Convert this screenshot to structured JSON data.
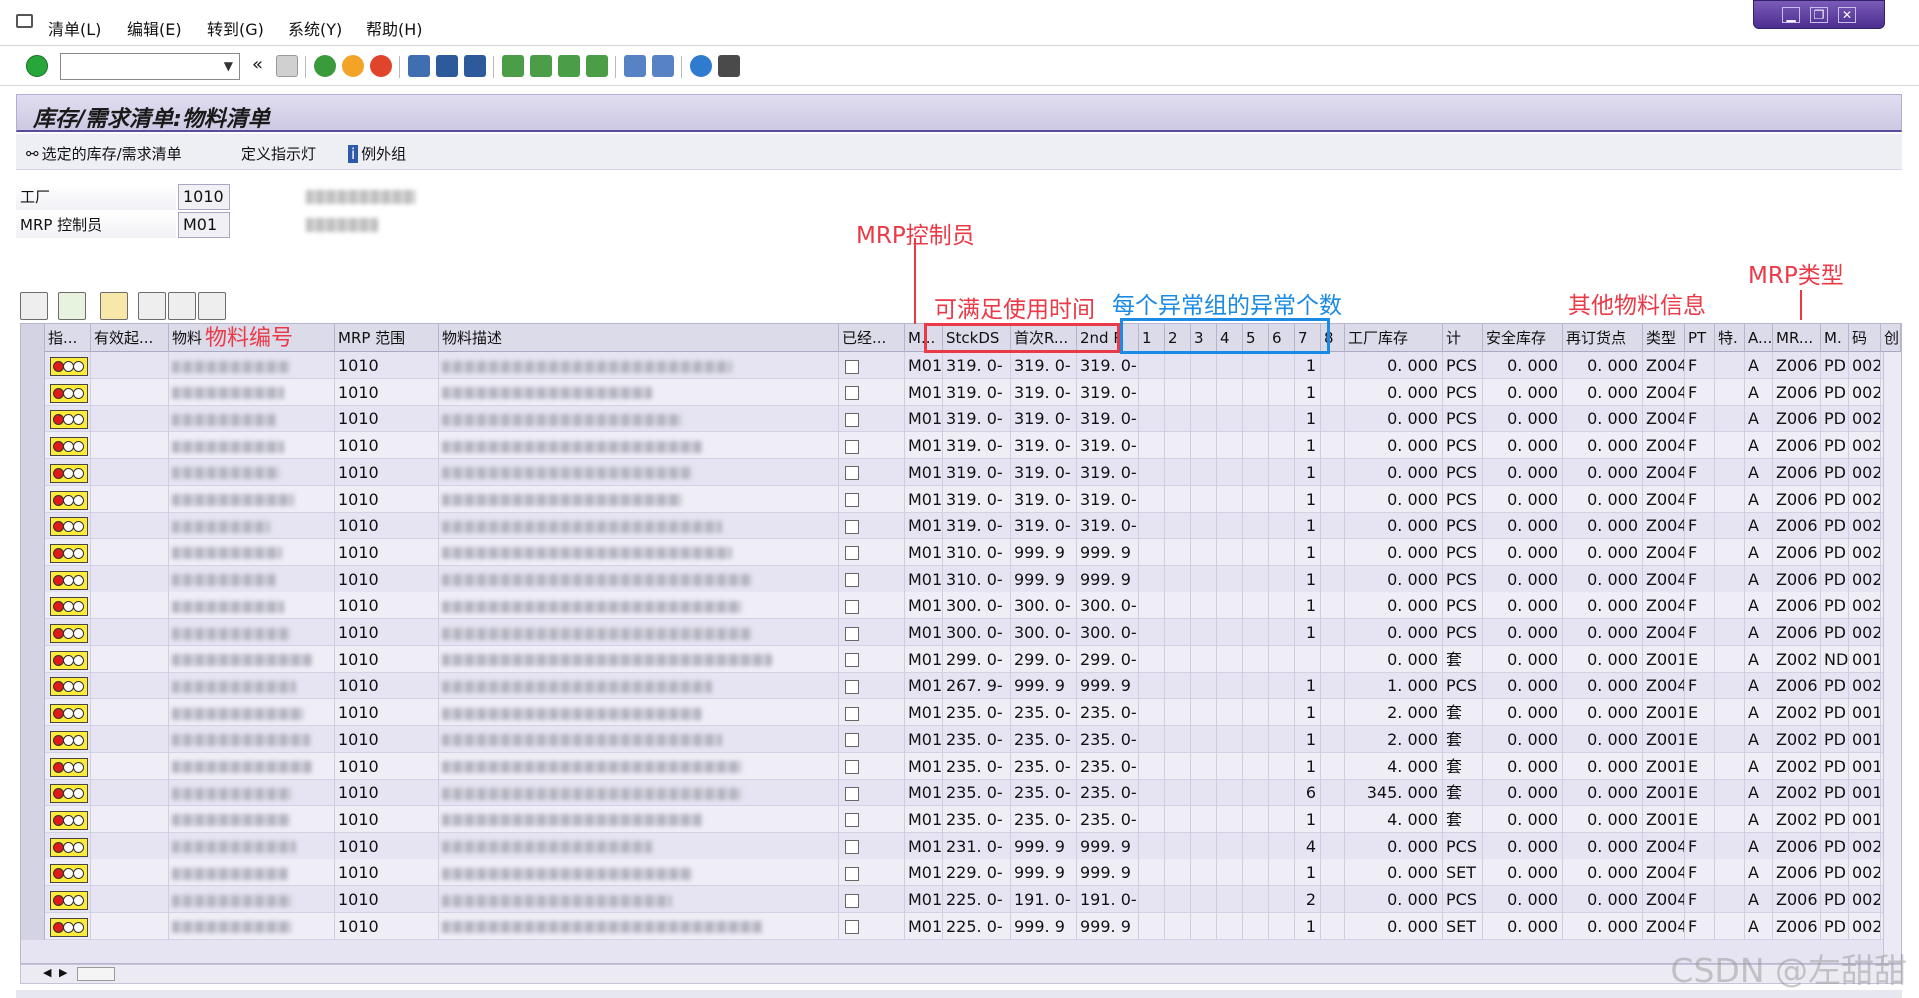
{
  "menu": [
    "清单(L)",
    "编辑(E)",
    "转到(G)",
    "系统(Y)",
    "帮助(H)"
  ],
  "toolbar": {
    "command_placeholder": "",
    "collapse_label": "«"
  },
  "window_controls": [
    "▁",
    "❐",
    "✕"
  ],
  "title": "库存/需求清单:物料清单",
  "app_buttons": {
    "selected_list": "选定的库存/需求清单",
    "define_indicator": "定义指示灯",
    "exception_groups": "例外组"
  },
  "filters": {
    "plant_label": "工厂",
    "plant_value": "1010",
    "mrp_controller_label": "MRP 控制员",
    "mrp_controller_value": "M01"
  },
  "annotations": {
    "mrp_controller": "MRP控制员",
    "available_time": "可满足使用时间",
    "exception_count": "每个异常组的异常个数",
    "other_info": "其他物料信息",
    "mrp_type": "MRP类型",
    "material_number": "物料编号"
  },
  "columns": {
    "indicator": "指...",
    "valid_from": "有效起...",
    "material": "物料",
    "mrp_area": "MRP 范围",
    "description": "物料描述",
    "processed": "已经...",
    "mrp_ctrl": "M...",
    "stockds": "StckDS",
    "first_r": "首次R...",
    "second_r": "2nd R",
    "g1": "1",
    "g2": "2",
    "g3": "3",
    "g4": "4",
    "g5": "5",
    "g6": "6",
    "g7": "7",
    "g8": "8",
    "plant_stock": "工厂库存",
    "unit": "计",
    "safety_stock": "安全库存",
    "reorder_point": "再订货点",
    "mat_type": "类型",
    "proc_type": "PT",
    "special": "特.",
    "abc": "A...",
    "mrp_type": "MR...",
    "lot": "M.",
    "code": "码",
    "flag": "创"
  },
  "rows": [
    {
      "area": "1010",
      "mrp": "M01",
      "sd": "319. 0-",
      "fr": "319. 0-",
      "sr": "319. 0-",
      "g7": "1",
      "stock": "0. 000",
      "unit": "PCS",
      "safety": "0. 000",
      "reorder": "0. 000",
      "type": "Z004",
      "pt": "F",
      "abc": "A",
      "mrptype": "Z006",
      "lot": "PD",
      "code": "002"
    },
    {
      "area": "1010",
      "mrp": "M01",
      "sd": "319. 0-",
      "fr": "319. 0-",
      "sr": "319. 0-",
      "g7": "1",
      "stock": "0. 000",
      "unit": "PCS",
      "safety": "0. 000",
      "reorder": "0. 000",
      "type": "Z004",
      "pt": "F",
      "abc": "A",
      "mrptype": "Z006",
      "lot": "PD",
      "code": "002"
    },
    {
      "area": "1010",
      "mrp": "M01",
      "sd": "319. 0-",
      "fr": "319. 0-",
      "sr": "319. 0-",
      "g7": "1",
      "stock": "0. 000",
      "unit": "PCS",
      "safety": "0. 000",
      "reorder": "0. 000",
      "type": "Z004",
      "pt": "F",
      "abc": "A",
      "mrptype": "Z006",
      "lot": "PD",
      "code": "002"
    },
    {
      "area": "1010",
      "mrp": "M01",
      "sd": "319. 0-",
      "fr": "319. 0-",
      "sr": "319. 0-",
      "g7": "1",
      "stock": "0. 000",
      "unit": "PCS",
      "safety": "0. 000",
      "reorder": "0. 000",
      "type": "Z004",
      "pt": "F",
      "abc": "A",
      "mrptype": "Z006",
      "lot": "PD",
      "code": "002"
    },
    {
      "area": "1010",
      "mrp": "M01",
      "sd": "319. 0-",
      "fr": "319. 0-",
      "sr": "319. 0-",
      "g7": "1",
      "stock": "0. 000",
      "unit": "PCS",
      "safety": "0. 000",
      "reorder": "0. 000",
      "type": "Z004",
      "pt": "F",
      "abc": "A",
      "mrptype": "Z006",
      "lot": "PD",
      "code": "002"
    },
    {
      "area": "1010",
      "mrp": "M01",
      "sd": "319. 0-",
      "fr": "319. 0-",
      "sr": "319. 0-",
      "g7": "1",
      "stock": "0. 000",
      "unit": "PCS",
      "safety": "0. 000",
      "reorder": "0. 000",
      "type": "Z004",
      "pt": "F",
      "abc": "A",
      "mrptype": "Z006",
      "lot": "PD",
      "code": "002"
    },
    {
      "area": "1010",
      "mrp": "M01",
      "sd": "319. 0-",
      "fr": "319. 0-",
      "sr": "319. 0-",
      "g7": "1",
      "stock": "0. 000",
      "unit": "PCS",
      "safety": "0. 000",
      "reorder": "0. 000",
      "type": "Z004",
      "pt": "F",
      "abc": "A",
      "mrptype": "Z006",
      "lot": "PD",
      "code": "002"
    },
    {
      "area": "1010",
      "mrp": "M01",
      "sd": "310. 0-",
      "fr": "999. 9",
      "sr": "999. 9",
      "g7": "1",
      "stock": "0. 000",
      "unit": "PCS",
      "safety": "0. 000",
      "reorder": "0. 000",
      "type": "Z004",
      "pt": "F",
      "abc": "A",
      "mrptype": "Z006",
      "lot": "PD",
      "code": "002"
    },
    {
      "area": "1010",
      "mrp": "M01",
      "sd": "310. 0-",
      "fr": "999. 9",
      "sr": "999. 9",
      "g7": "1",
      "stock": "0. 000",
      "unit": "PCS",
      "safety": "0. 000",
      "reorder": "0. 000",
      "type": "Z004",
      "pt": "F",
      "abc": "A",
      "mrptype": "Z006",
      "lot": "PD",
      "code": "002"
    },
    {
      "area": "1010",
      "mrp": "M01",
      "sd": "300. 0-",
      "fr": "300. 0-",
      "sr": "300. 0-",
      "g7": "1",
      "stock": "0. 000",
      "unit": "PCS",
      "safety": "0. 000",
      "reorder": "0. 000",
      "type": "Z004",
      "pt": "F",
      "abc": "A",
      "mrptype": "Z006",
      "lot": "PD",
      "code": "002"
    },
    {
      "area": "1010",
      "mrp": "M01",
      "sd": "300. 0-",
      "fr": "300. 0-",
      "sr": "300. 0-",
      "g7": "1",
      "stock": "0. 000",
      "unit": "PCS",
      "safety": "0. 000",
      "reorder": "0. 000",
      "type": "Z004",
      "pt": "F",
      "abc": "A",
      "mrptype": "Z006",
      "lot": "PD",
      "code": "002"
    },
    {
      "area": "1010",
      "mrp": "M01",
      "sd": "299. 0-",
      "fr": "299. 0-",
      "sr": "299. 0-",
      "g7": "",
      "stock": "0. 000",
      "unit": "套",
      "safety": "0. 000",
      "reorder": "0. 000",
      "type": "Z001",
      "pt": "E",
      "abc": "A",
      "mrptype": "Z002",
      "lot": "ND",
      "code": "001"
    },
    {
      "area": "1010",
      "mrp": "M01",
      "sd": "267. 9-",
      "fr": "999. 9",
      "sr": "999. 9",
      "g7": "1",
      "stock": "1. 000",
      "unit": "PCS",
      "safety": "0. 000",
      "reorder": "0. 000",
      "type": "Z004",
      "pt": "F",
      "abc": "A",
      "mrptype": "Z006",
      "lot": "PD",
      "code": "002"
    },
    {
      "area": "1010",
      "mrp": "M01",
      "sd": "235. 0-",
      "fr": "235. 0-",
      "sr": "235. 0-",
      "g7": "1",
      "stock": "2. 000",
      "unit": "套",
      "safety": "0. 000",
      "reorder": "0. 000",
      "type": "Z001",
      "pt": "E",
      "abc": "A",
      "mrptype": "Z002",
      "lot": "PD",
      "code": "001"
    },
    {
      "area": "1010",
      "mrp": "M01",
      "sd": "235. 0-",
      "fr": "235. 0-",
      "sr": "235. 0-",
      "g7": "1",
      "stock": "2. 000",
      "unit": "套",
      "safety": "0. 000",
      "reorder": "0. 000",
      "type": "Z001",
      "pt": "E",
      "abc": "A",
      "mrptype": "Z002",
      "lot": "PD",
      "code": "001"
    },
    {
      "area": "1010",
      "mrp": "M01",
      "sd": "235. 0-",
      "fr": "235. 0-",
      "sr": "235. 0-",
      "g7": "1",
      "stock": "4. 000",
      "unit": "套",
      "safety": "0. 000",
      "reorder": "0. 000",
      "type": "Z001",
      "pt": "E",
      "abc": "A",
      "mrptype": "Z002",
      "lot": "PD",
      "code": "001"
    },
    {
      "area": "1010",
      "mrp": "M01",
      "sd": "235. 0-",
      "fr": "235. 0-",
      "sr": "235. 0-",
      "g7": "6",
      "stock": "345. 000",
      "unit": "套",
      "safety": "0. 000",
      "reorder": "0. 000",
      "type": "Z001",
      "pt": "E",
      "abc": "A",
      "mrptype": "Z002",
      "lot": "PD",
      "code": "001"
    },
    {
      "area": "1010",
      "mrp": "M01",
      "sd": "235. 0-",
      "fr": "235. 0-",
      "sr": "235. 0-",
      "g7": "1",
      "stock": "4. 000",
      "unit": "套",
      "safety": "0. 000",
      "reorder": "0. 000",
      "type": "Z001",
      "pt": "E",
      "abc": "A",
      "mrptype": "Z002",
      "lot": "PD",
      "code": "001"
    },
    {
      "area": "1010",
      "mrp": "M01",
      "sd": "231. 0-",
      "fr": "999. 9",
      "sr": "999. 9",
      "g7": "4",
      "stock": "0. 000",
      "unit": "PCS",
      "safety": "0. 000",
      "reorder": "0. 000",
      "type": "Z004",
      "pt": "F",
      "abc": "A",
      "mrptype": "Z006",
      "lot": "PD",
      "code": "002"
    },
    {
      "area": "1010",
      "mrp": "M01",
      "sd": "229. 0-",
      "fr": "999. 9",
      "sr": "999. 9",
      "g7": "1",
      "stock": "0. 000",
      "unit": "SET",
      "safety": "0. 000",
      "reorder": "0. 000",
      "type": "Z004",
      "pt": "F",
      "abc": "A",
      "mrptype": "Z006",
      "lot": "PD",
      "code": "002"
    },
    {
      "area": "1010",
      "mrp": "M01",
      "sd": "225. 0-",
      "fr": "191. 0-",
      "sr": "191. 0-",
      "g7": "2",
      "stock": "0. 000",
      "unit": "PCS",
      "safety": "0. 000",
      "reorder": "0. 000",
      "type": "Z004",
      "pt": "F",
      "abc": "A",
      "mrptype": "Z006",
      "lot": "PD",
      "code": "002"
    },
    {
      "area": "1010",
      "mrp": "M01",
      "sd": "225. 0-",
      "fr": "999. 9",
      "sr": "999. 9",
      "g7": "1",
      "stock": "0. 000",
      "unit": "SET",
      "safety": "0. 000",
      "reorder": "0. 000",
      "type": "Z004",
      "pt": "F",
      "abc": "A",
      "mrptype": "Z006",
      "lot": "PD",
      "code": "002"
    }
  ],
  "watermark": "CSDN @左甜甜",
  "colors": {
    "annotation_red": "#ea3a48",
    "annotation_blue": "#1a8ae2",
    "header_purple": "#5a4b9c"
  }
}
